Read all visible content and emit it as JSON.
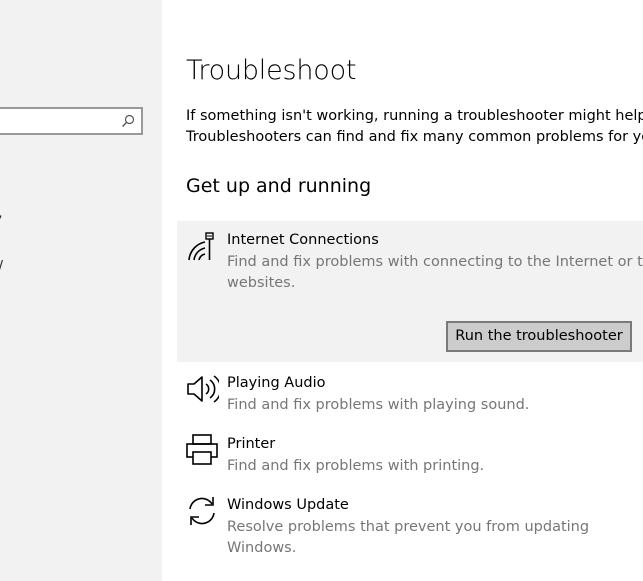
{
  "search": {
    "value": "",
    "icon": "search-icon"
  },
  "page": {
    "title": "Troubleshoot",
    "description_line1": "If something isn't working, running a troubleshooter might help.",
    "description_line2": "Troubleshooters can find and fix many common problems for you.",
    "section_heading": "Get up and running"
  },
  "troubleshooters": [
    {
      "icon": "wifi-network-icon",
      "title": "Internet Connections",
      "description_line1": "Find and fix problems with connecting to the Internet or to",
      "description_line2": "websites.",
      "selected": true
    },
    {
      "icon": "speaker-icon",
      "title": "Playing Audio",
      "description_line1": "Find and fix problems with playing sound.",
      "selected": false
    },
    {
      "icon": "printer-icon",
      "title": "Printer",
      "description_line1": "Find and fix problems with printing.",
      "selected": false
    },
    {
      "icon": "refresh-icon",
      "title": "Windows Update",
      "description_line1": "Resolve problems that prevent you from updating",
      "description_line2": "Windows.",
      "selected": false
    }
  ],
  "run_button": {
    "label": "Run the troubleshooter"
  },
  "colors": {
    "sidebar_bg": "#f2f2f2",
    "selected_bg": "#f2f2f2",
    "secondary_text": "#767676",
    "button_bg": "#cccccc",
    "button_border": "#7a7a7a"
  }
}
